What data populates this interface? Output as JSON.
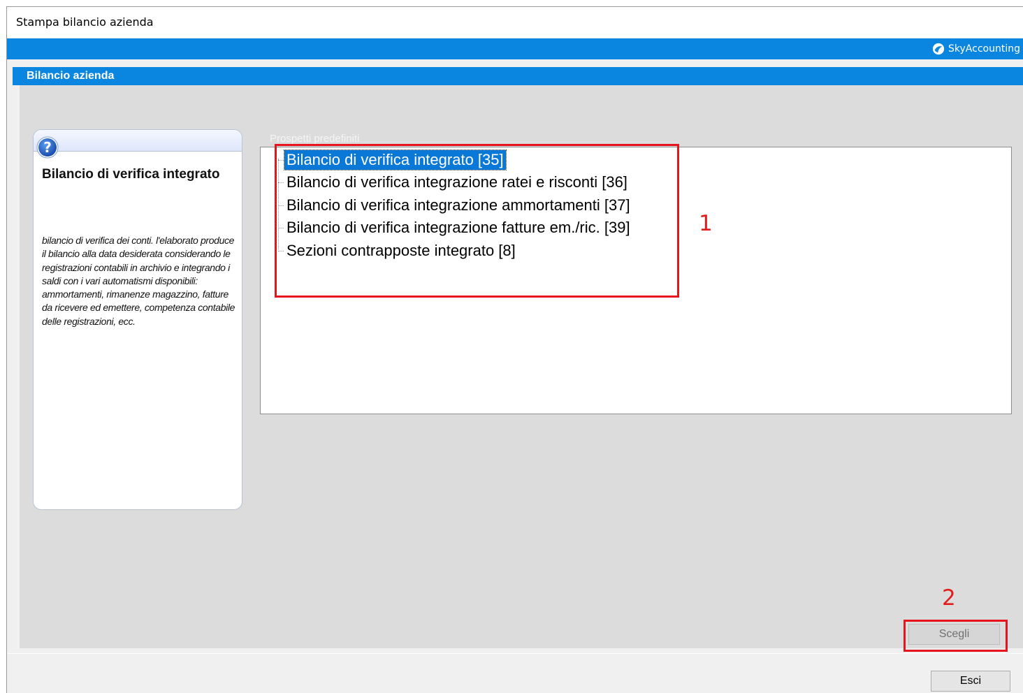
{
  "window": {
    "title": "Stampa bilancio azienda"
  },
  "brand": {
    "name": "SkyAccounting",
    "color": "#0a86e0"
  },
  "section": {
    "title": "Bilancio azienda"
  },
  "help": {
    "icon": "question-mark-icon",
    "title": "Bilancio di verifica integrato",
    "description": "bilancio di verifica dei conti. l'elaborato produce il bilancio alla data desiderata considerando le registrazioni contabili in archivio e integrando i saldi con i vari automatismi disponibili: ammortamenti, rimanenze magazzino, fatture da ricevere ed emettere, competenza contabile delle registrazioni, ecc."
  },
  "list": {
    "label": "Prospetti predefiniti",
    "items": [
      {
        "label": "Bilancio di verifica integrato [35]",
        "selected": true
      },
      {
        "label": "Bilancio di verifica integrazione ratei e risconti [36]",
        "selected": false
      },
      {
        "label": "Bilancio di verifica integrazione ammortamenti [37]",
        "selected": false
      },
      {
        "label": "Bilancio di verifica integrazione fatture em./ric. [39]",
        "selected": false
      },
      {
        "label": "Sezioni contrapposte integrato [8]",
        "selected": false
      }
    ]
  },
  "annotations": {
    "first": "1",
    "second": "2",
    "color": "#e8131c"
  },
  "buttons": {
    "scegli": "Scegli",
    "esci": "Esci"
  }
}
